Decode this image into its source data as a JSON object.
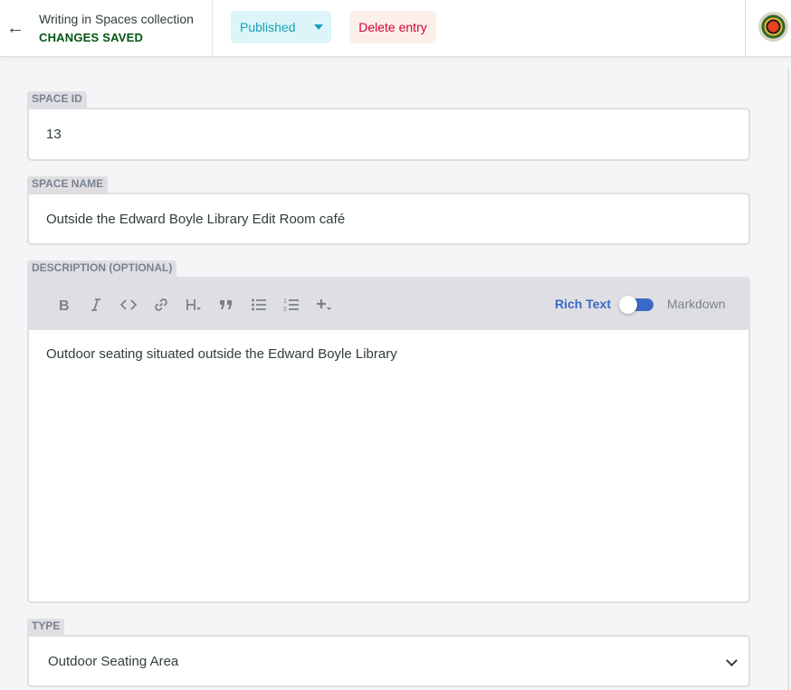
{
  "header": {
    "back_icon": "←",
    "collection_title": "Writing in Spaces collection",
    "save_status": "CHANGES SAVED",
    "status_label": "Published",
    "delete_label": "Delete entry"
  },
  "fields": {
    "space_id": {
      "label": "SPACE ID",
      "value": "13"
    },
    "space_name": {
      "label": "SPACE NAME",
      "value": "Outside the Edward Boyle Library Edit Room café"
    },
    "description": {
      "label": "DESCRIPTION (OPTIONAL)",
      "value": "Outdoor seating situated outside the Edward Boyle Library",
      "mode_rich": "Rich Text",
      "mode_markdown": "Markdown",
      "toolbar": [
        "bold-icon",
        "italic-icon",
        "code-icon",
        "link-icon",
        "heading-icon",
        "quote-icon",
        "bulleted-list-icon",
        "numbered-list-icon",
        "add-component-icon"
      ]
    },
    "type": {
      "label": "TYPE",
      "value": "Outdoor Seating Area"
    }
  },
  "colors": {
    "accent": "#3a69c7",
    "published": "#17a2b8",
    "danger": "#d60032",
    "saved": "#005614"
  }
}
